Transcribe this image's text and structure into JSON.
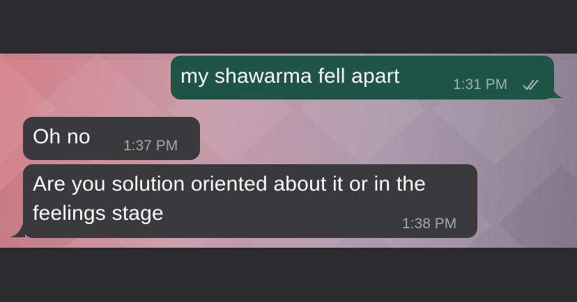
{
  "messages": [
    {
      "direction": "outgoing",
      "text": "my shawarma fell apart",
      "time": "1:31 PM",
      "status_icon": "double-check-read-icon"
    },
    {
      "direction": "incoming",
      "text": "Oh no",
      "time": "1:37 PM"
    },
    {
      "direction": "incoming",
      "text": "Are you solution oriented about it or in the feelings stage",
      "time": "1:38 PM"
    }
  ],
  "colors": {
    "outgoing_bubble": "#1e5545",
    "incoming_bubble": "#3a3a3c",
    "letterbox_bars": "#2b2b2d"
  }
}
